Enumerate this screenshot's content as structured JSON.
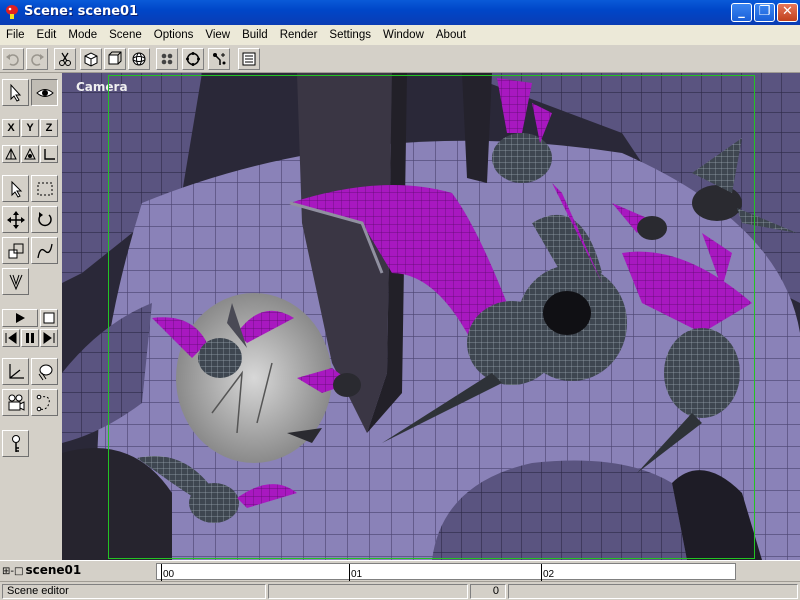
{
  "window": {
    "title": "Scene: scene01",
    "buttons": [
      "_",
      "❐",
      "✕"
    ]
  },
  "menu": [
    "File",
    "Edit",
    "Mode",
    "Scene",
    "Options",
    "View",
    "Build",
    "Render",
    "Settings",
    "Window",
    "About"
  ],
  "toolbar": {
    "buttons": [
      {
        "name": "undo-icon",
        "enabled": false
      },
      {
        "name": "redo-icon",
        "enabled": false
      },
      {
        "name": "cut-icon",
        "enabled": true
      },
      {
        "name": "cube-solid-icon",
        "enabled": true
      },
      {
        "name": "cube-wire-icon",
        "enabled": true
      },
      {
        "name": "sphere-icon",
        "enabled": true
      },
      {
        "name": "particles-icon",
        "enabled": true
      },
      {
        "name": "target-icon",
        "enabled": true
      },
      {
        "name": "sparkle-icon",
        "enabled": true
      },
      {
        "name": "list-icon",
        "enabled": true
      }
    ]
  },
  "left_tools": {
    "axis_labels": [
      "X",
      "Y",
      "Z"
    ],
    "icons": [
      "select-arrow-icon",
      "eye-icon",
      "axis-x-button",
      "axis-y-button",
      "axis-z-button",
      "coord-local-icon",
      "coord-parent-icon",
      "coord-world-icon",
      "select-icon",
      "rect-select-icon",
      "move-icon",
      "rotate-icon",
      "scale-icon",
      "curve-icon",
      "bones-icon",
      "play-icon",
      "stop-icon",
      "prev-icon",
      "pause-icon",
      "next-icon",
      "axes-icon",
      "sphere-select-icon",
      "camera-icon",
      "path-icon",
      "key-icon"
    ]
  },
  "viewport": {
    "label": "Camera",
    "frame_color": "#23c323"
  },
  "timeline": {
    "scene_name": "scene01",
    "tree_icon": "⊞-□",
    "ticks": [
      "00",
      "01",
      "02"
    ]
  },
  "status": {
    "mode": "Scene editor",
    "frame": "0"
  },
  "colors": {
    "wing": "#b020c8",
    "floor": "#7c74a8",
    "accent": "#0a5ad8"
  }
}
